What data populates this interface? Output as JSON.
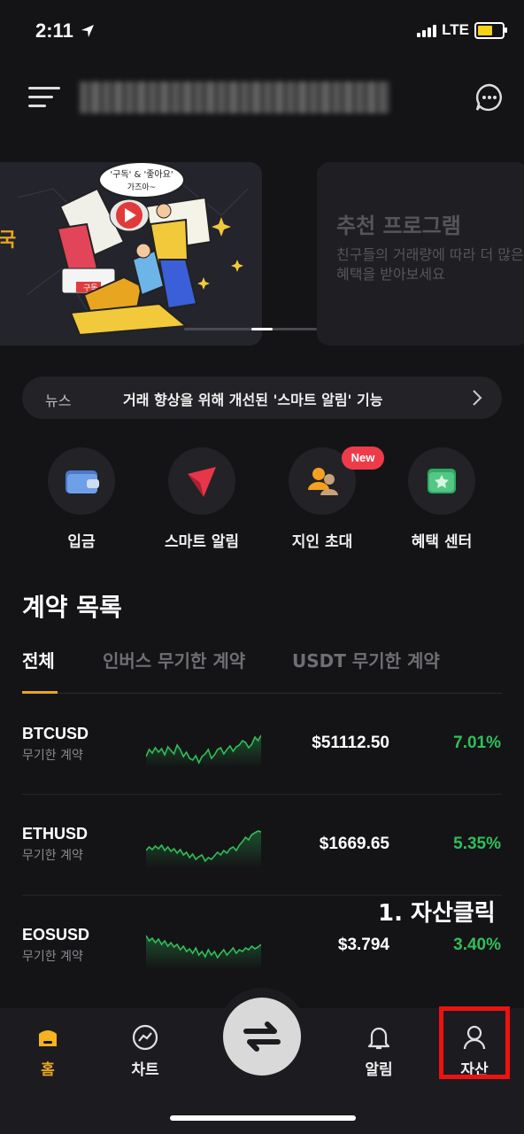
{
  "status_bar": {
    "time": "2:11",
    "network": "LTE"
  },
  "header": {
    "account_name_blurred": ""
  },
  "banners": [
    {
      "speech_bubble_line1": "'구독' & '좋아요'",
      "speech_bubble_line2": "가즈아~",
      "side_text": "국",
      "tag": "구독"
    },
    {
      "title": "추천 프로그램",
      "description": "친구들의 거래량에 따라 더 많은 혜택을 받아보세요"
    }
  ],
  "news": {
    "label": "뉴스",
    "text": "거래 향상을 위해 개선된 '스마트 알림' 기능"
  },
  "quick_menu": [
    {
      "label": "입금",
      "icon": "wallet-icon"
    },
    {
      "label": "스마트 알림",
      "icon": "arrow-alert-icon"
    },
    {
      "label": "지인 초대",
      "icon": "invite-friends-icon",
      "badge": "New"
    },
    {
      "label": "혜택 센터",
      "icon": "reward-ticket-icon"
    }
  ],
  "contracts": {
    "title": "계약 목록",
    "tabs": [
      "전체",
      "인버스 무기한 계약",
      "USDT 무기한 계약"
    ],
    "rows": [
      {
        "symbol": "BTCUSD",
        "type": "무기한 계약",
        "price": "$51112.50",
        "change": "7.01%",
        "spark": [
          38,
          30,
          34,
          28,
          33,
          29,
          36,
          27,
          31,
          35,
          25,
          30,
          38,
          33,
          40,
          42,
          37,
          45,
          38,
          35,
          30,
          40,
          36,
          30,
          28,
          35,
          30,
          26,
          32,
          27,
          25,
          20,
          22,
          28,
          24,
          16,
          20,
          14
        ]
      },
      {
        "symbol": "ETHUSD",
        "type": "무기한 계약",
        "price": "$1669.65",
        "change": "5.35%",
        "spark": [
          30,
          26,
          29,
          25,
          28,
          24,
          30,
          26,
          31,
          28,
          33,
          29,
          35,
          32,
          38,
          34,
          40,
          37,
          35,
          42,
          38,
          40,
          36,
          32,
          35,
          30,
          33,
          28,
          26,
          30,
          24,
          20,
          15,
          18,
          12,
          10,
          8,
          9
        ]
      },
      {
        "symbol": "EOSUSD",
        "type": "무기한 계약",
        "price": "$3.794",
        "change": "3.40%",
        "spark": [
          12,
          18,
          15,
          20,
          16,
          22,
          18,
          24,
          20,
          25,
          22,
          28,
          24,
          30,
          27,
          32,
          26,
          34,
          30,
          36,
          28,
          34,
          30,
          37,
          32,
          28,
          34,
          30,
          26,
          32,
          28,
          30,
          26,
          28,
          24,
          27,
          25,
          22
        ]
      }
    ]
  },
  "annotation": "1. 자산클릭",
  "bottom_nav": [
    {
      "label": "홈",
      "icon": "home-icon",
      "active": true
    },
    {
      "label": "차트",
      "icon": "chart-icon"
    },
    {
      "label": "알림",
      "icon": "bell-icon"
    },
    {
      "label": "자산",
      "icon": "user-icon"
    }
  ],
  "colors": {
    "accent": "#e8a520",
    "positive": "#2fbf5a",
    "highlight": "#ee1111",
    "badge": "#ee3b4a"
  }
}
